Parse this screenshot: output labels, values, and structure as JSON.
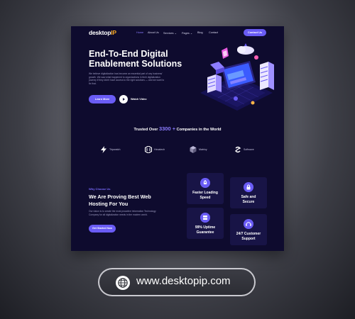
{
  "brand": {
    "name_main": "desktop",
    "name_accent": "IP"
  },
  "nav": {
    "items": [
      {
        "label": "Home",
        "active": true
      },
      {
        "label": "About Us",
        "active": false
      },
      {
        "label": "Services ⌄",
        "active": false
      },
      {
        "label": "Pages ⌄",
        "active": false
      },
      {
        "label": "Blog",
        "active": false
      },
      {
        "label": "Contact",
        "active": false
      }
    ],
    "cta": "Contact Us"
  },
  "hero": {
    "title_line1": "End-To-End Digital",
    "title_line2": "Enablement Solutions",
    "description": "We believe digitalization has become an essential part of any business' growth. We saw what happened to organizations in their digitalization journey if they didn't have access to the right solutions — and we want to fix that.",
    "learn_more": "Learn More",
    "watch_video": "Watch Video"
  },
  "trusted": {
    "prefix": "Trusted Over",
    "count": "3300 +",
    "suffix": "Companies in the World"
  },
  "partners": [
    {
      "name": "Tripwatch",
      "icon": "bolt-logo-icon"
    },
    {
      "name": "Hexatech",
      "icon": "hex-logo-icon"
    },
    {
      "name": "Matrixy",
      "icon": "cube-logo-icon"
    },
    {
      "name": "Softwave",
      "icon": "swirl-logo-icon"
    }
  ],
  "why": {
    "label": "Why Choose Us",
    "title_line1": "We Are Proving Best Web",
    "title_line2": "Hosting For You",
    "description": "Our vision is to create the most proactive Information Technology Company for all digitalization needs in the modern world.",
    "cta": "Get Started Now"
  },
  "features": [
    {
      "line1": "Faster Loading",
      "line2": "Speed",
      "icon": "rocket-icon"
    },
    {
      "line1": "Safe and",
      "line2": "Secure",
      "icon": "lock-icon"
    },
    {
      "line1": "99% Uptime",
      "line2": "Guarantee",
      "icon": "server-icon"
    },
    {
      "line1": "24/7 Customer",
      "line2": "Support",
      "icon": "headset-icon"
    }
  ],
  "footer": {
    "url": "www.desktopip.com",
    "icon": "globe-icon"
  },
  "colors": {
    "page_bg": "#0e0b2e",
    "accent": "#6a5cf5",
    "logo_accent": "#f5a623",
    "card_bg": "#181446"
  }
}
